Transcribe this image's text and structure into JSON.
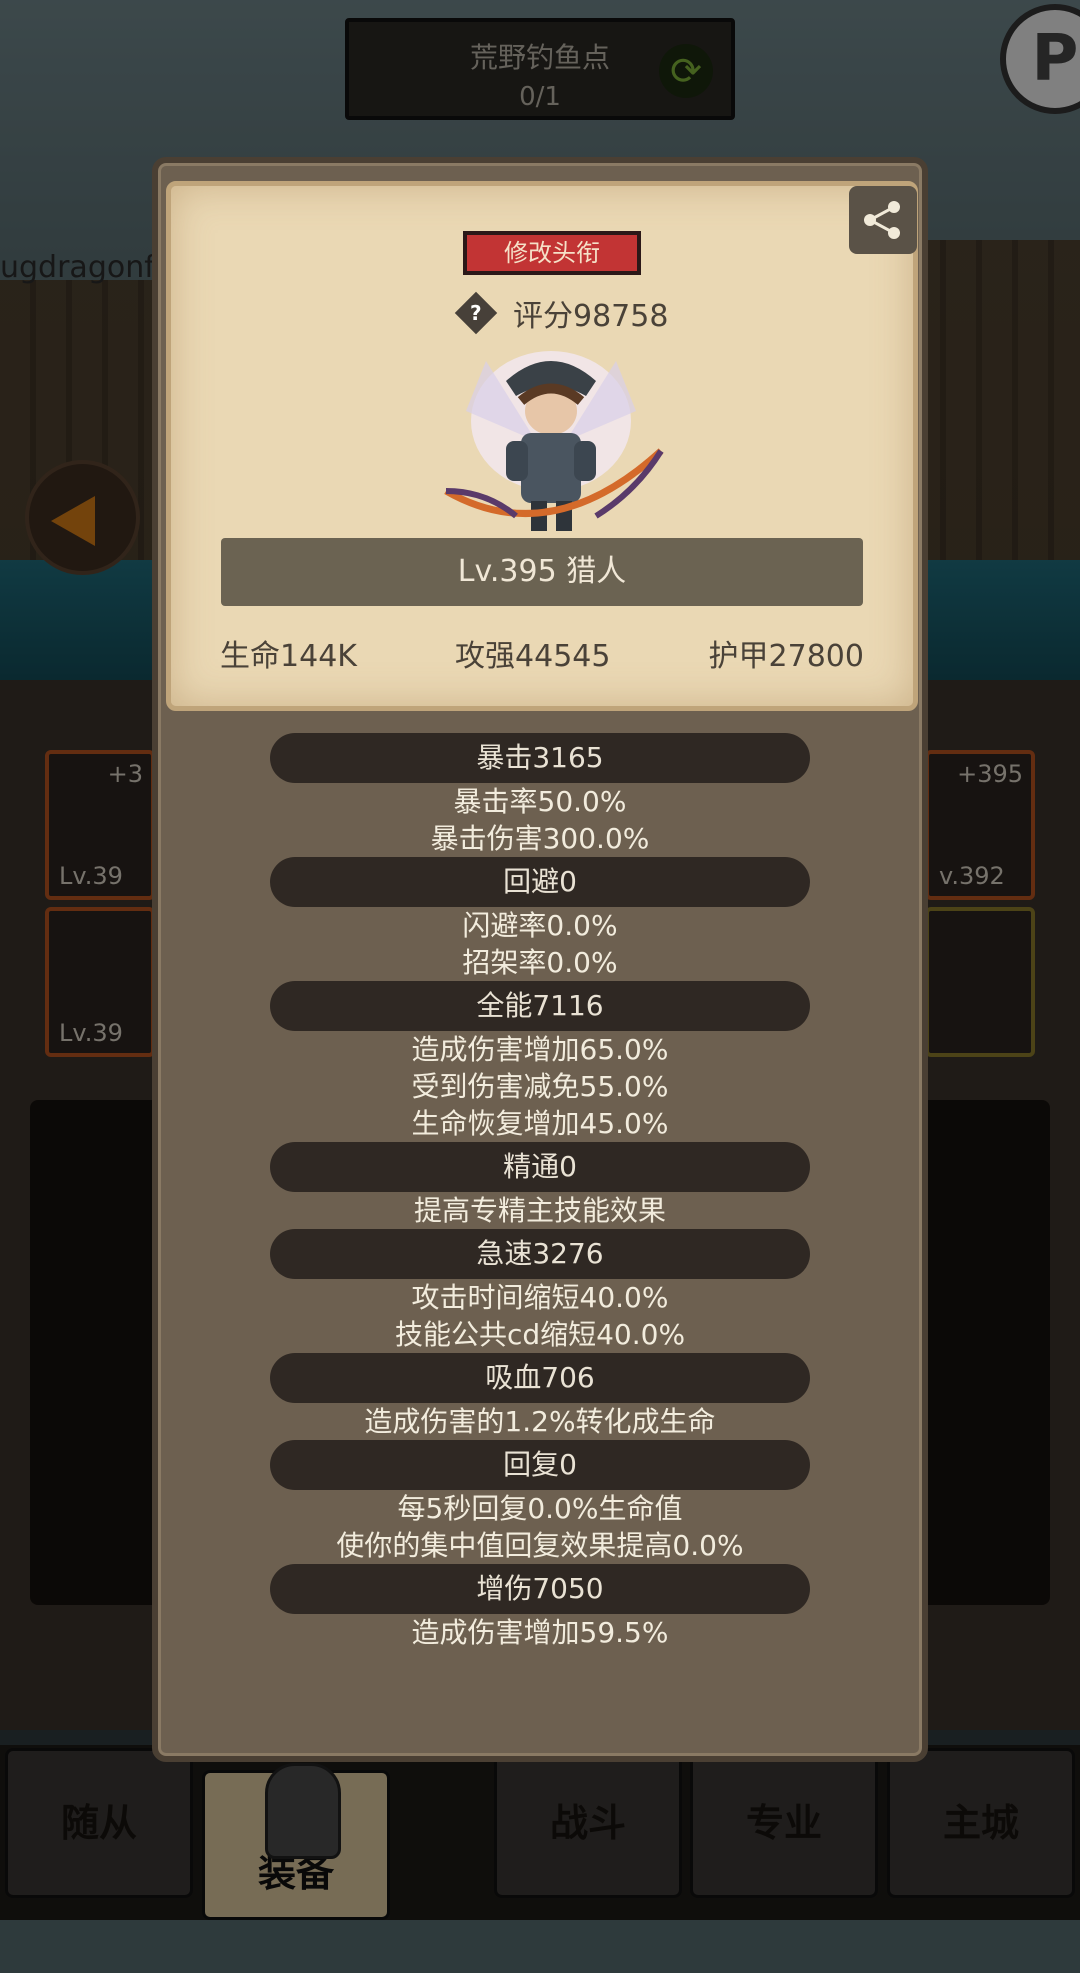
{
  "location": {
    "name": "荒野钓鱼点",
    "count": "0/1"
  },
  "background": {
    "watermark": "ugdragonfr",
    "slots": [
      {
        "top": "+3",
        "bottom": "Lv.39"
      },
      {
        "top": "",
        "bottom": "Lv.39"
      },
      {
        "top": "+395",
        "bottom": "v.392"
      },
      {
        "top": "",
        "bottom": ""
      }
    ]
  },
  "character": {
    "title_button": "修改头衔",
    "score": "评分98758",
    "level_class": "Lv.395 猎人",
    "stats": {
      "life": "生命144K",
      "attack": "攻强44545",
      "armor": "护甲27800"
    }
  },
  "stat_groups": [
    {
      "header": "暴击3165",
      "lines": [
        "暴击率50.0%",
        "暴击伤害300.0%"
      ]
    },
    {
      "header": "回避0",
      "lines": [
        "闪避率0.0%",
        "招架率0.0%"
      ]
    },
    {
      "header": "全能7116",
      "lines": [
        "造成伤害增加65.0%",
        "受到伤害减免55.0%",
        "生命恢复增加45.0%"
      ]
    },
    {
      "header": "精通0",
      "lines": [
        "提高专精主技能效果"
      ]
    },
    {
      "header": "急速3276",
      "lines": [
        "攻击时间缩短40.0%",
        "技能公共cd缩短40.0%"
      ]
    },
    {
      "header": "吸血706",
      "lines": [
        "造成伤害的1.2%转化成生命"
      ]
    },
    {
      "header": "回复0",
      "lines": [
        "每5秒回复0.0%生命值",
        "使你的集中值回复效果提高0.0%"
      ]
    },
    {
      "header": "增伤7050",
      "lines": [
        "造成伤害增加59.5%"
      ]
    }
  ],
  "nav": {
    "followers": "随从",
    "equipment": "装备",
    "battle": "战斗",
    "profession": "专业",
    "main_city": "主城"
  },
  "colors": {
    "title_button": "#c23434",
    "card_bg": "#ead8b4",
    "modal_bg": "#6d6050",
    "stat_header_bg": "#2f2823"
  }
}
